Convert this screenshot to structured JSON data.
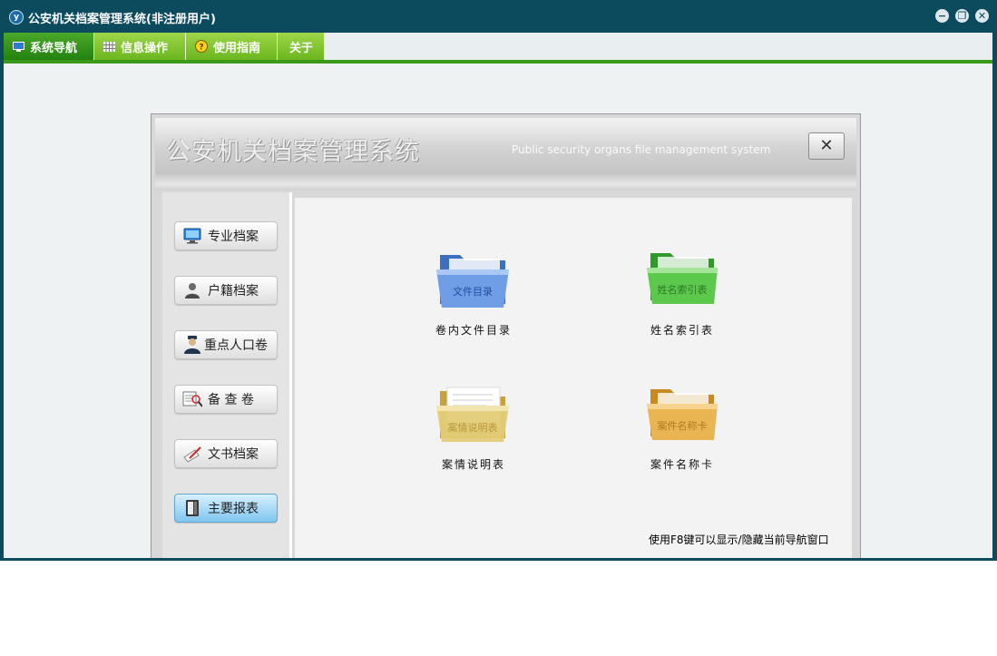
{
  "window": {
    "title": "公安机关档案管理系统(非注册用户)",
    "app_icon_label": "y"
  },
  "menubar": {
    "items": [
      {
        "label": "系统导航",
        "icon": "monitor-icon",
        "active": true
      },
      {
        "label": "信息操作",
        "icon": "grid-icon",
        "active": false
      },
      {
        "label": "使用指南",
        "icon": "help-icon",
        "active": false
      },
      {
        "label": "关于",
        "icon": "",
        "active": false
      }
    ]
  },
  "panel": {
    "title_cn": "公安机关档案管理系统",
    "title_en": "Public security organs file management system",
    "close_glyph": "✕"
  },
  "sidebar": {
    "items": [
      {
        "label": "专业档案",
        "icon": "monitor-icon"
      },
      {
        "label": "户籍档案",
        "icon": "person-icon"
      },
      {
        "label": "重点人口卷",
        "icon": "officer-icon"
      },
      {
        "label": "备 查 卷",
        "icon": "magnifier-document-icon"
      },
      {
        "label": "文书档案",
        "icon": "pen-paper-icon"
      },
      {
        "label": "主要报表",
        "icon": "binder-icon",
        "active": true
      }
    ]
  },
  "tiles": [
    {
      "caption": "卷内文件目录",
      "folder_text": "文件目录",
      "color": "#5d8fd9"
    },
    {
      "caption": "姓名索引表",
      "folder_text": "姓名索引表",
      "color": "#4cbd3e"
    },
    {
      "caption": "案情说明表",
      "folder_text": "案情说明表",
      "color": "#d9bd5b"
    },
    {
      "caption": "案件名称卡",
      "folder_text": "案件名称卡",
      "color": "#dea845"
    }
  ],
  "hint": "使用F8键可以显示/隐藏当前导航窗口",
  "colors": {
    "titlebar": "#0c4a5e",
    "menu_green": "#6bb61e",
    "menu_active": "#23820f",
    "accent_line": "#3b9a1a"
  }
}
